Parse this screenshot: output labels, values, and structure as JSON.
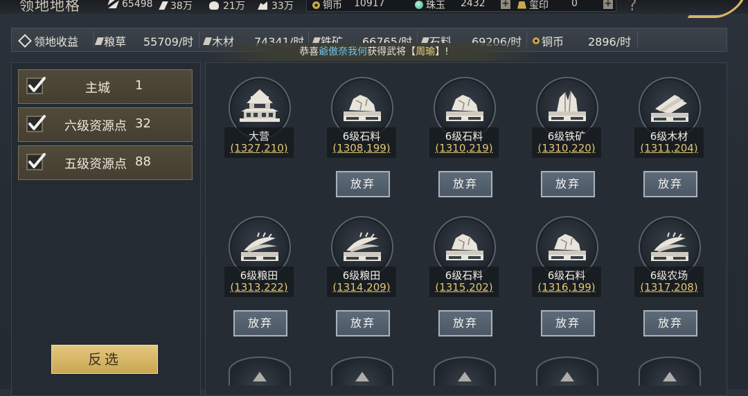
{
  "header": {
    "title": "领地地格",
    "resources": [
      {
        "icon": "grain-icon",
        "value": "65498"
      },
      {
        "icon": "wood-icon",
        "value": "38万"
      },
      {
        "icon": "iron-icon",
        "value": "21万"
      },
      {
        "icon": "stone-icon",
        "value": "33万"
      }
    ],
    "currencies": {
      "copper": {
        "label": "铜币",
        "value": "10917"
      },
      "jade": {
        "label": "珠玉",
        "value": "2432"
      },
      "seal": {
        "label": "玺印",
        "value": "0"
      }
    },
    "plus": "+",
    "help": "?"
  },
  "income": {
    "title": "领地收益",
    "items": [
      {
        "label": "粮草",
        "value": "55709/时"
      },
      {
        "label": "木材",
        "value": "74341/时"
      },
      {
        "label": "铁矿",
        "value": "66765/时"
      },
      {
        "label": "石料",
        "value": "69206/时"
      },
      {
        "label": "铜币",
        "value": "2896/时"
      }
    ]
  },
  "notice": {
    "prefix": "恭喜",
    "player": "爺傲奈我何",
    "middle": "获得武将【",
    "hero": "周瑜",
    "suffix": "】!"
  },
  "filters": [
    {
      "label": "主城",
      "count": "1",
      "checked": true
    },
    {
      "label": "六级资源点",
      "count": "32",
      "checked": true
    },
    {
      "label": "五级资源点",
      "count": "88",
      "checked": true
    }
  ],
  "invert_label": "反选",
  "abandon_label": "放弃",
  "tiles": [
    {
      "name": "大营",
      "coord": "(1327,210)",
      "icon": "camp-icon"
    },
    {
      "name": "6级石料",
      "coord": "(1308,199)",
      "icon": "stone-icon"
    },
    {
      "name": "6级石料",
      "coord": "(1310,219)",
      "icon": "stone-icon"
    },
    {
      "name": "6级铁矿",
      "coord": "(1310,220)",
      "icon": "iron-icon"
    },
    {
      "name": "6级木材",
      "coord": "(1311,204)",
      "icon": "wood-icon"
    },
    {
      "name": "6级粮田",
      "coord": "(1313,222)",
      "icon": "grain-icon"
    },
    {
      "name": "6级粮田",
      "coord": "(1314,209)",
      "icon": "grain-icon"
    },
    {
      "name": "6级石料",
      "coord": "(1315,202)",
      "icon": "stone-icon"
    },
    {
      "name": "6级石料",
      "coord": "(1316,199)",
      "icon": "stone-icon"
    },
    {
      "name": "6级农场",
      "coord": "(1317,208)",
      "icon": "grain-icon"
    }
  ]
}
